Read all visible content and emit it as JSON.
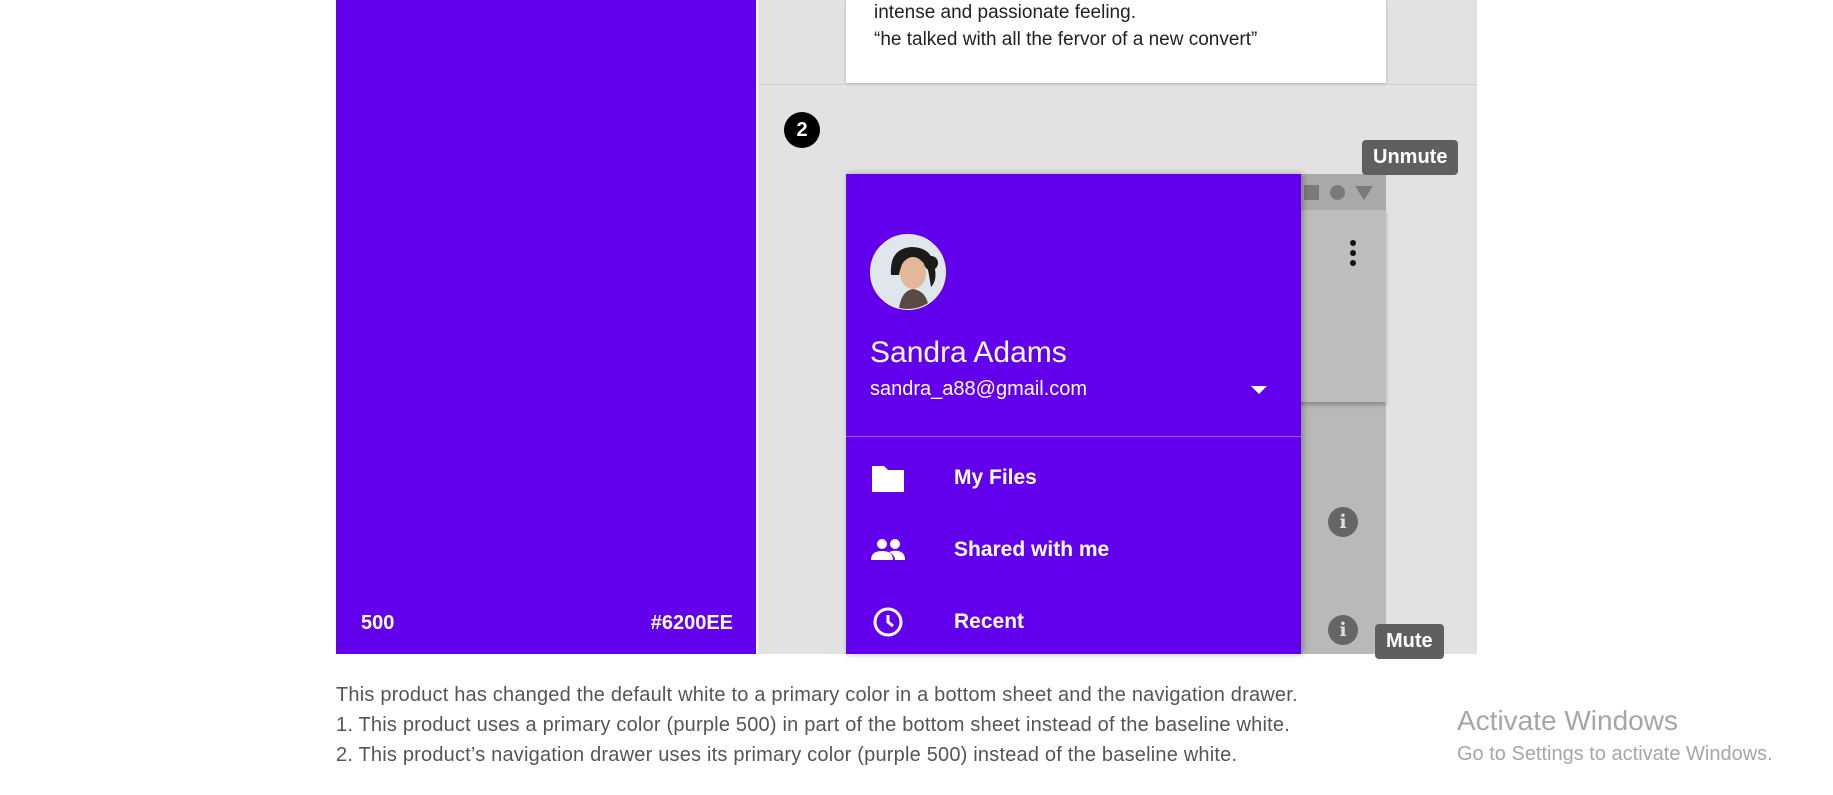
{
  "swatch": {
    "color": "#6200EE",
    "weight": "500",
    "hex_label": "#6200EE"
  },
  "top_card": {
    "line1": "intense and passionate feeling.",
    "line2": "“he talked with all the fervor of a new convert”"
  },
  "step_badge": "2",
  "drawer": {
    "user_name": "Sandra Adams",
    "user_email": "sandra_a88@gmail.com",
    "items": [
      {
        "label": "My Files",
        "icon": "folder-icon"
      },
      {
        "label": "Shared with me",
        "icon": "people-icon"
      },
      {
        "label": "Recent",
        "icon": "clock-icon"
      }
    ]
  },
  "overlay": {
    "unmute_label": "Unmute",
    "mute_label": "Mute"
  },
  "caption": {
    "line1": "This product has changed the default white to a primary color in a bottom sheet and the navigation drawer.",
    "line2": "1. This product uses a primary color (purple 500) in part of the bottom sheet instead of the baseline white.",
    "line3": "2. This product’s navigation drawer uses its primary color (purple 500) instead of the baseline white."
  },
  "watermark": {
    "title": "Activate Windows",
    "subtitle": "Go to Settings to activate Windows."
  }
}
